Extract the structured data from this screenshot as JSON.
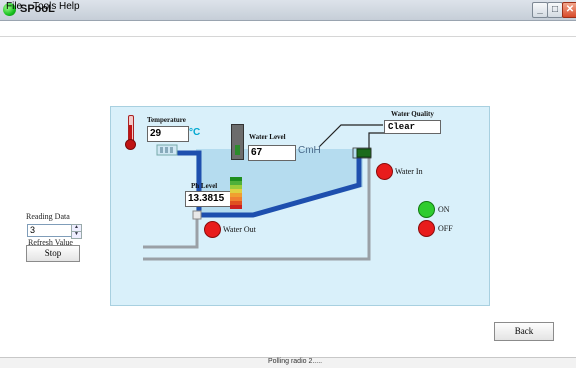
{
  "window": {
    "title": "SPooL"
  },
  "menu": {
    "file": "File",
    "tools": "Tools",
    "help": "Help"
  },
  "controls": {
    "reading_label": "Reading Data",
    "reading_value": "3",
    "refresh_label": "Refresh Value",
    "stop_label": "Stop",
    "back_label": "Back"
  },
  "schematic": {
    "temperature": {
      "label": "Temperature",
      "value": "29",
      "unit": "°C"
    },
    "water_level": {
      "label": "Water Level",
      "value": "67",
      "unit": "CmH"
    },
    "water_quality": {
      "label": "Water Quality",
      "value": "Clear"
    },
    "ph_level": {
      "label": "Ph Level",
      "value": "13.3815"
    },
    "indicators": {
      "water_in": {
        "label": "Water In",
        "color": "#e81c1c"
      },
      "water_out": {
        "label": "Water Out",
        "color": "#e81c1c"
      },
      "on": {
        "label": "ON",
        "color": "#2ecc2e"
      },
      "off": {
        "label": "OFF",
        "color": "#e81c1c"
      }
    }
  },
  "status": {
    "text": "Polling radio 2....."
  },
  "colors": {
    "panel_bg": "#d9f0fa",
    "pool_water": "#b5dcef",
    "pool_wall": "#1e4fae"
  }
}
